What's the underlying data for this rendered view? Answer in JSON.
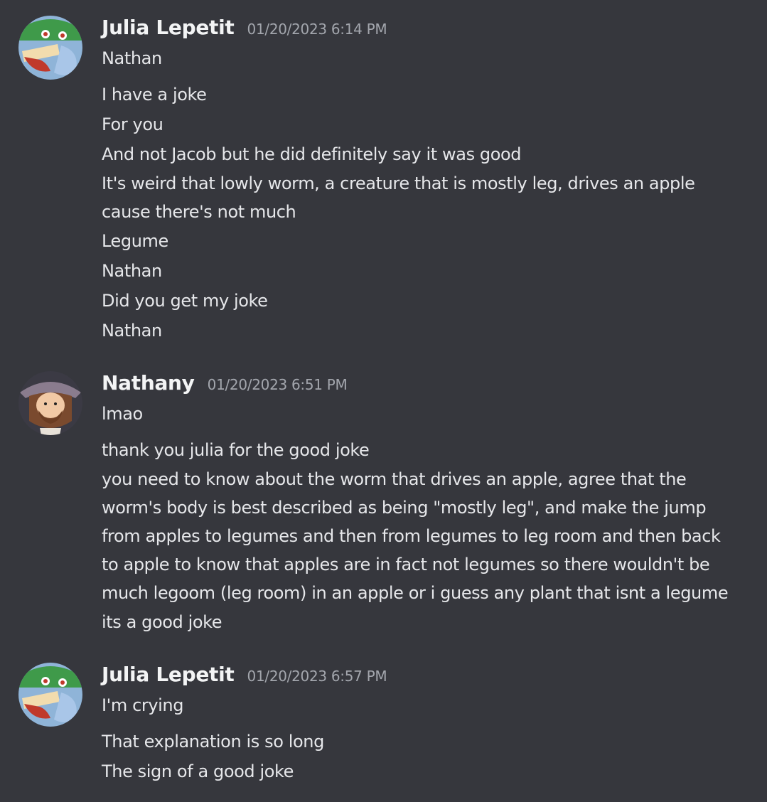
{
  "colors": {
    "background": "#36373d",
    "username": "#f3f4f5",
    "timestamp": "#a3a6ad",
    "message_text": "#e6e7ea"
  },
  "groups": [
    {
      "username": "Julia Lepetit",
      "timestamp": "01/20/2023 6:14 PM",
      "avatar": "julia-avatar-icon",
      "messages": [
        "Nathan",
        "I have a joke",
        "For you",
        "And not Jacob but he did definitely say it was good",
        "It's weird that lowly worm, a creature that is mostly leg, drives an apple cause there's not much",
        "Legume",
        "Nathan",
        "Did you get my joke",
        "Nathan"
      ]
    },
    {
      "username": "Nathany",
      "timestamp": "01/20/2023 6:51 PM",
      "avatar": "nathany-avatar-icon",
      "messages": [
        "lmao",
        "thank you julia for the good joke",
        "you need to know about the worm that drives an apple, agree that the worm's body is best described as being \"mostly leg\", and make the jump from apples to legumes and then from legumes to leg room and then back to apple to know that apples are in fact not legumes so there wouldn't be much legoom (leg room) in an apple or i guess any plant that isnt a legume",
        "its a good joke"
      ]
    },
    {
      "username": "Julia Lepetit",
      "timestamp": "01/20/2023 6:57 PM",
      "avatar": "julia-avatar-icon",
      "messages": [
        "I'm crying",
        "That explanation is so long",
        "The sign of a good joke"
      ]
    }
  ]
}
